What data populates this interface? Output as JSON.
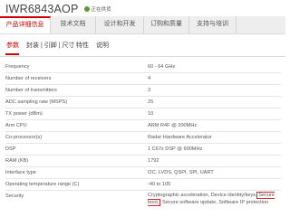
{
  "header": {
    "title": "IWR6843AOP",
    "status": "正在供货"
  },
  "nav": {
    "tabs": [
      {
        "label": "产品详细信息",
        "active": true
      },
      {
        "label": "技术文档",
        "active": false
      },
      {
        "label": "设计和开发",
        "active": false
      },
      {
        "label": "订购和质量",
        "active": false
      },
      {
        "label": "支持与培训",
        "active": false
      }
    ]
  },
  "subtabs": [
    {
      "label": "参数",
      "active": true
    },
    {
      "label": "封装 | 引脚 | 尺寸",
      "active": false
    },
    {
      "label": "特性",
      "active": false
    },
    {
      "label": "说明",
      "active": false
    }
  ],
  "specs": [
    {
      "label": "Frequency",
      "value": "60 - 64 GHz"
    },
    {
      "label": "Number of receivers",
      "value": "4"
    },
    {
      "label": "Number of transmitters",
      "value": "3"
    },
    {
      "label": "ADC sampling rate (MSPS)",
      "value": "25"
    },
    {
      "label": "TX power (dBm)",
      "value": "10"
    },
    {
      "label": "Arm CPU",
      "value": "ARM R4F @ 200MHz"
    },
    {
      "label": "Co-processor(s)",
      "value": "Radar Hardware Accelerator"
    },
    {
      "label": "DSP",
      "value": "1 C67x DSP @ 600MHz"
    },
    {
      "label": "RAM (KB)",
      "value": "1792"
    },
    {
      "label": "Interface type",
      "value": "I2C, LVDS, QSPI, SPI, UART"
    },
    {
      "label": "Operating temperature range (C)",
      "value": "-40 to 105"
    },
    {
      "label": "Security",
      "value_before": "Cryptographic acceleration, Device identity/keys,",
      "value_highlight": "Secure boot,",
      "value_after": "Secure software update, Software IP protection"
    }
  ],
  "colors": {
    "accent": "#cc0000",
    "status_green": "#5a9b2e",
    "highlight_box": "#d9262c"
  }
}
